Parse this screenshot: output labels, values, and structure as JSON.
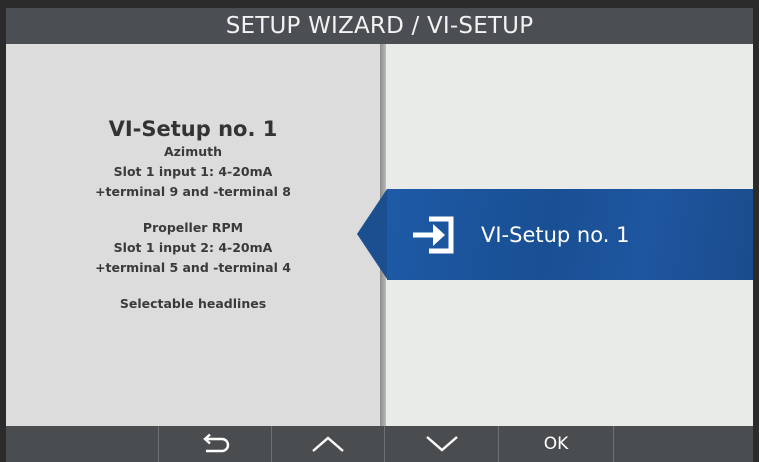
{
  "header": {
    "title": "SETUP WIZARD / VI-SETUP"
  },
  "info": {
    "heading": "VI-Setup no. 1",
    "block1": [
      "Azimuth",
      "Slot 1 input 1: 4-20mA",
      "+terminal 9 and -terminal 8"
    ],
    "block2": [
      "Propeller RPM",
      "Slot 1 input 2: 4-20mA",
      "+terminal 5 and -terminal 4"
    ],
    "block3": [
      "Selectable headlines"
    ]
  },
  "selection": {
    "label": "VI-Setup no. 1",
    "icon": "enter-icon"
  },
  "footer": {
    "buttons": [
      {
        "icon": "back-arrow-icon"
      },
      {
        "icon": "chevron-up-icon"
      },
      {
        "icon": "chevron-down-icon"
      },
      {
        "label": "OK"
      }
    ]
  },
  "colors": {
    "accent": "#1e56a0",
    "header": "#4b4e52",
    "panel_left": "#dcdcdc",
    "panel_right": "#e9ebe9"
  }
}
